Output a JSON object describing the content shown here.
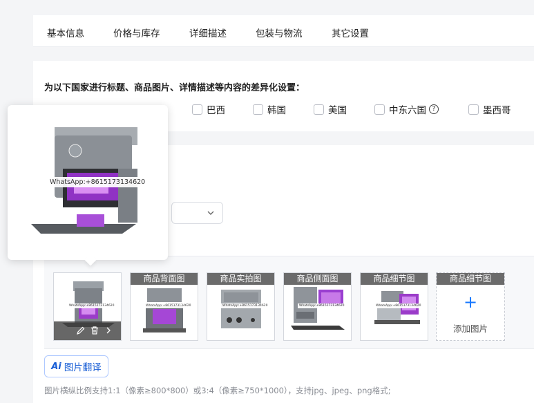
{
  "tabs": [
    "基本信息",
    "价格与库存",
    "详细描述",
    "包装与物流",
    "其它设置"
  ],
  "countries": {
    "title": "为以下国家进行标题、商品图片、详情描述等内容的差异化设置：",
    "items": [
      "巴西",
      "韩国",
      "美国",
      "中东六国",
      "墨西哥"
    ],
    "help_icon": "question-circle-icon"
  },
  "gallery": {
    "items": [
      {
        "label": "",
        "icon": "product-photo"
      },
      {
        "label": "商品背面图",
        "icon": "product-photo"
      },
      {
        "label": "商品实拍图",
        "icon": "product-photo"
      },
      {
        "label": "商品侧面图",
        "icon": "product-photo"
      },
      {
        "label": "商品细节图",
        "icon": "product-photo"
      }
    ],
    "add": {
      "label": "商品细节图",
      "plus": "+",
      "text": "添加图片"
    },
    "toolbar_icons": [
      "edit-icon",
      "delete-icon",
      "chevron-right-icon"
    ]
  },
  "translate": {
    "ai_mark": "Ai",
    "label": "图片翻译"
  },
  "hint": "图片横纵比例支持1:1（像素≥800*800）或3:4（像素≥750*1000），支持jpg、jpeg、png格式;",
  "preview": {
    "watermark": "WhatsApp:+8615173134620"
  },
  "colors": {
    "accent": "#1677ff",
    "label_bg": "#6b6b6b"
  }
}
